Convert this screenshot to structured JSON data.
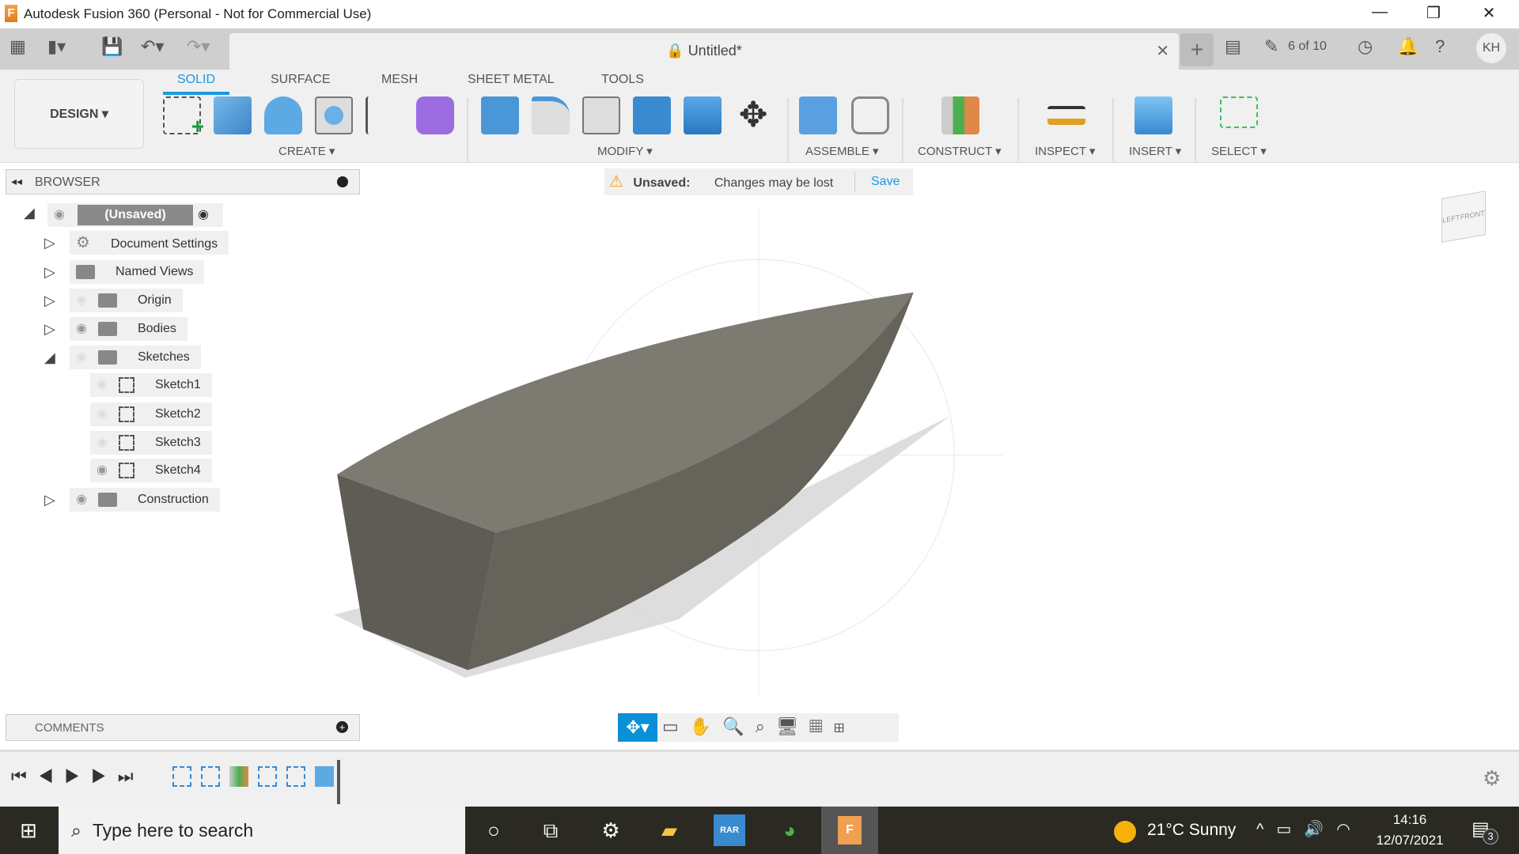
{
  "window": {
    "title": "Autodesk Fusion 360 (Personal - Not for Commercial Use)",
    "app_icon_letter": "F"
  },
  "quickbar": {
    "doc_title": "Untitled*",
    "job_status": "6 of 10",
    "user_initials": "KH"
  },
  "ribbon": {
    "workspace": "DESIGN",
    "tabs": [
      {
        "label": "SOLID",
        "active": true
      },
      {
        "label": "SURFACE"
      },
      {
        "label": "MESH"
      },
      {
        "label": "SHEET METAL"
      },
      {
        "label": "TOOLS"
      }
    ],
    "groups": [
      "CREATE",
      "MODIFY",
      "ASSEMBLE",
      "CONSTRUCT",
      "INSPECT",
      "INSERT",
      "SELECT"
    ]
  },
  "browser": {
    "title": "BROWSER",
    "root": "(Unsaved)",
    "items": [
      {
        "label": "Document Settings",
        "icon": "gear-icon"
      },
      {
        "label": "Named Views",
        "icon": "folder-icon"
      },
      {
        "label": "Origin",
        "icon": "folder-icon",
        "visible": false
      },
      {
        "label": "Bodies",
        "icon": "folder-icon",
        "visible": true
      },
      {
        "label": "Sketches",
        "icon": "folder-icon",
        "visible": false,
        "expanded": true
      },
      {
        "label": "Sketch1",
        "icon": "sketch-icon",
        "visible": false
      },
      {
        "label": "Sketch2",
        "icon": "sketch-icon",
        "visible": false
      },
      {
        "label": "Sketch3",
        "icon": "sketch-icon",
        "visible": false
      },
      {
        "label": "Sketch4",
        "icon": "sketch-icon",
        "visible": true
      },
      {
        "label": "Construction",
        "icon": "folder-icon",
        "visible": true
      }
    ]
  },
  "banner": {
    "status": "Unsaved:",
    "message": "Changes may be lost",
    "action": "Save"
  },
  "viewcube": {
    "left": "LEFT",
    "front": "FRONT"
  },
  "comments": {
    "title": "COMMENTS"
  },
  "taskbar": {
    "search_placeholder": "Type here to search",
    "weather": "21°C  Sunny",
    "time": "14:16",
    "date": "12/07/2021",
    "notifications": "3",
    "rar_label": "RAR"
  },
  "colors": {
    "accent": "#1a9ae0",
    "body": "#7a776e",
    "taskbar": "#2a2a22"
  }
}
